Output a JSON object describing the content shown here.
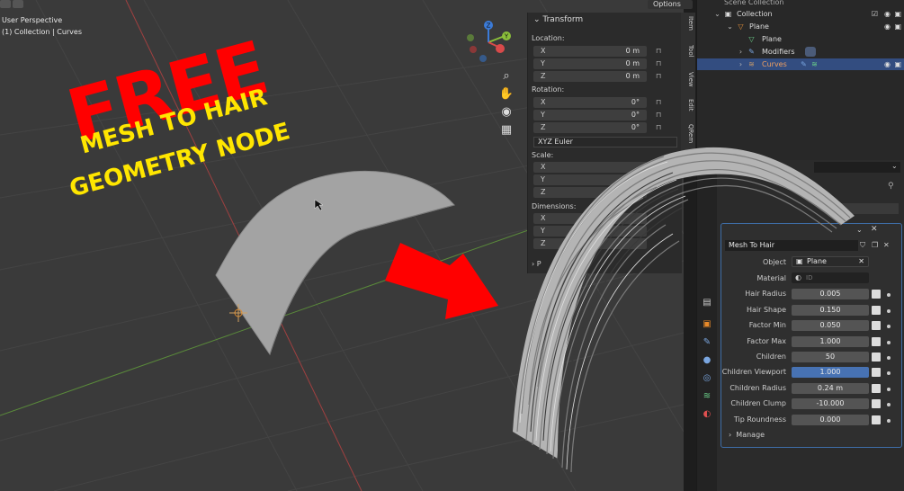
{
  "viewport": {
    "perspective_label": "User Perspective",
    "collection_label": "(1) Collection | Curves",
    "options_label": "Options"
  },
  "promo": {
    "free": "FREE",
    "line1": "MESH TO HAIR",
    "line2": "GEOMETRY NODE",
    "text_color": "#ffe600",
    "free_color": "#ff0000"
  },
  "gizmo": {
    "x": "X",
    "y": "Y",
    "z": "Z"
  },
  "npanel": {
    "header": "Transform",
    "location_label": "Location:",
    "rotation_label": "Rotation:",
    "scale_label": "Scale:",
    "dimensions_label": "Dimensions:",
    "location": [
      {
        "axis": "X",
        "value": "0 m"
      },
      {
        "axis": "Y",
        "value": "0 m"
      },
      {
        "axis": "Z",
        "value": "0 m"
      }
    ],
    "rotation": [
      {
        "axis": "X",
        "value": "0°"
      },
      {
        "axis": "Y",
        "value": "0°"
      },
      {
        "axis": "Z",
        "value": "0°"
      }
    ],
    "rotation_mode": "XYZ Euler",
    "scale": [
      {
        "axis": "X"
      },
      {
        "axis": "Y"
      },
      {
        "axis": "Z"
      }
    ],
    "dimensions": [
      {
        "axis": "X"
      },
      {
        "axis": "Y"
      },
      {
        "axis": "Z"
      }
    ],
    "properties_label": "P"
  },
  "side_tabs": [
    "Item",
    "Tool",
    "View",
    "Edit",
    "QRem"
  ],
  "outliner": {
    "scene_collection": "Scene Collection",
    "collection": "Collection",
    "plane_object": "Plane",
    "plane_mesh": "Plane",
    "modifiers": "Modifiers",
    "curves": "Curves"
  },
  "modifier": {
    "name": "Mesh To Hair",
    "object_label": "Object",
    "object_value": "Plane",
    "material_label": "Material",
    "material_placeholder": "ID",
    "fields": [
      {
        "label": "Hair Radius",
        "value": "0.005"
      },
      {
        "label": "Hair Shape",
        "value": "0.150"
      },
      {
        "label": "Factor Min",
        "value": "0.050"
      },
      {
        "label": "Factor Max",
        "value": "1.000"
      },
      {
        "label": "Children",
        "value": "50"
      },
      {
        "label": "Children Viewport",
        "value": "1.000"
      },
      {
        "label": "Children Radius",
        "value": "0.24 m"
      },
      {
        "label": "Children Clump",
        "value": "-10.000"
      },
      {
        "label": "Tip Roundness",
        "value": "0.000"
      }
    ],
    "manage_label": "Manage"
  },
  "colors": {
    "accent_blue": "#4772b3",
    "selected_row": "#334d80",
    "arrow_red": "#ff0000"
  }
}
